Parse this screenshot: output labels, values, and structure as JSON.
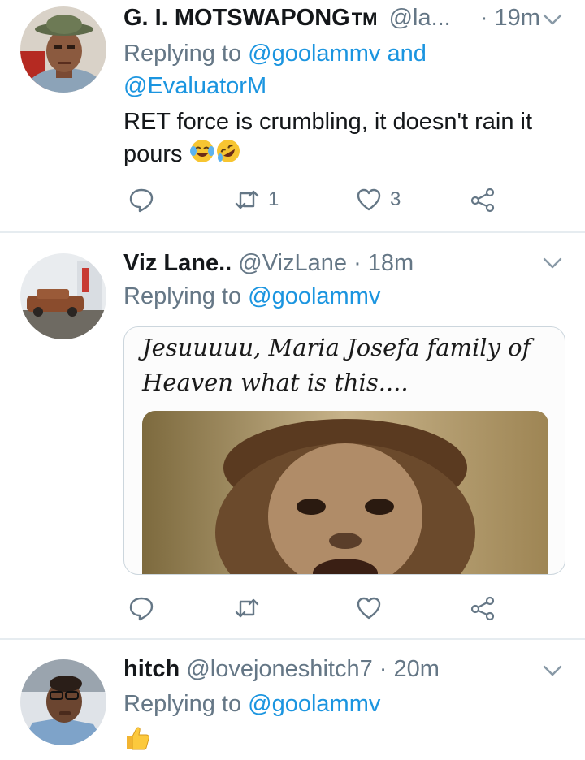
{
  "tweets": [
    {
      "name": "G. I. MOTSWAPONG",
      "badge": "TM",
      "handle": "@la...",
      "time": "· 19m",
      "reply_prefix": "Replying to",
      "reply_to_1": "@goolammv",
      "reply_and": "and",
      "reply_to_2": "@EvaluatorM",
      "text": "RET force is crumbling, it doesn't rain it pours",
      "emojis": [
        "face-with-tears-of-joy",
        "rolling-on-the-floor-laughing"
      ],
      "retweets": "1",
      "likes": "3"
    },
    {
      "name": "Viz Lane..",
      "handle": "@VizLane",
      "time": "· 18m",
      "reply_prefix": "Replying to",
      "reply_to_1": "@goolammv",
      "media_caption": "Jesuuuuu, Maria Josefa family of Heaven what is this....",
      "retweets": "",
      "likes": ""
    },
    {
      "name": "hitch",
      "handle": "@lovejoneshitch7",
      "time": "· 20m",
      "reply_prefix": "Replying to",
      "reply_to_1": "@goolammv",
      "emojis": [
        "thumbs-up"
      ]
    }
  ],
  "icons": {
    "reply": "reply-icon",
    "retweet": "retweet-icon",
    "like": "heart-icon",
    "share": "share-icon",
    "more": "chevron-down-icon"
  },
  "colors": {
    "link": "#1b95e0",
    "muted": "#657786",
    "text": "#14171a",
    "divider": "#e6ecf0"
  }
}
